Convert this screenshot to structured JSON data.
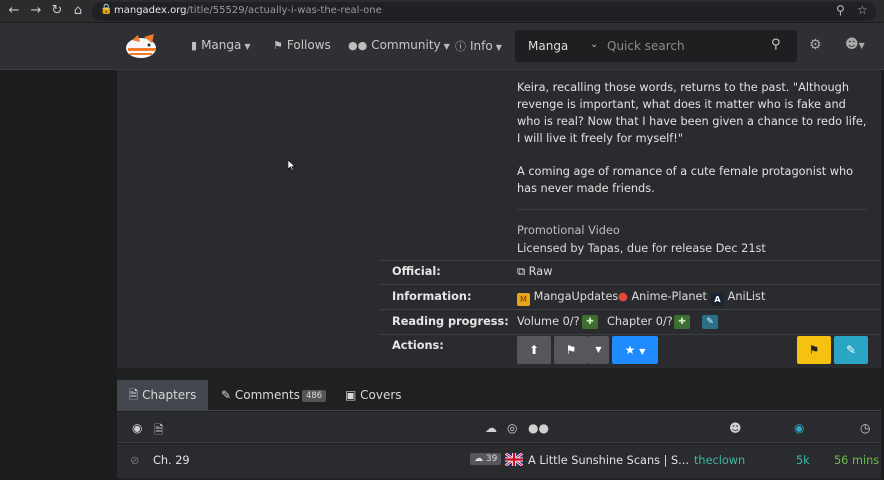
{
  "browser": {
    "url_host": "mangadex.org",
    "url_path": "/title/55529/actually-i-was-the-real-one"
  },
  "navbar": {
    "items": [
      {
        "label": "Manga",
        "icon": "book-icon",
        "dropdown": true
      },
      {
        "label": "Follows",
        "icon": "bookmark-icon",
        "dropdown": false
      },
      {
        "label": "Community",
        "icon": "users-icon",
        "dropdown": true
      },
      {
        "label": "Info",
        "icon": "info-icon",
        "dropdown": true
      }
    ],
    "search": {
      "category": "Manga",
      "placeholder": "Quick search"
    }
  },
  "description": {
    "para1": "Keira, recalling those words, returns to the past. \"Although revenge is important, what does it matter who is fake and who is real? Now that I have been given a chance to redo life, I will live it freely for myself!\"",
    "para2": "A coming age of romance of a cute female protagonist who has never made friends.",
    "promo": "Promotional Video",
    "license": "Licensed by Tapas, due for release Dec 21st"
  },
  "info_rows": {
    "official_label": "Official:",
    "official_value": "Raw",
    "information_label": "Information:",
    "links": [
      "MangaUpdates",
      "Anime-Planet",
      "AniList"
    ],
    "reading_label": "Reading progress:",
    "volume": "Volume 0/?",
    "chapter": "Chapter 0/?",
    "actions_label": "Actions:"
  },
  "tabs": {
    "chapters": "Chapters",
    "comments": "Comments",
    "comments_count": "486",
    "covers": "Covers"
  },
  "chapter_row": {
    "chapter": "Ch. 29",
    "comments": "39",
    "group": "A Little Sunshine Scans | S...",
    "uploader": "theclown",
    "views": "5k",
    "time": "56 mins"
  },
  "colors": {
    "accent_blue": "#1e8bff",
    "flag_yellow": "#f5c211",
    "edit_teal": "#2aa6c4",
    "green": "#6abe45",
    "uploader": "#3cb9a4"
  }
}
